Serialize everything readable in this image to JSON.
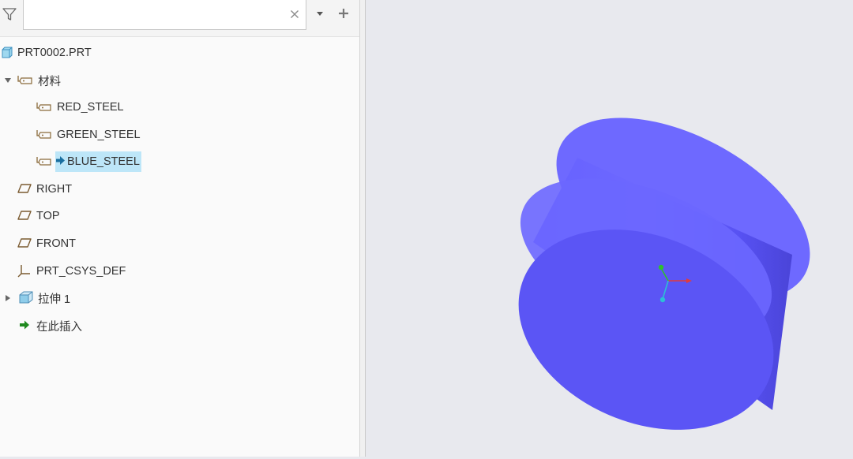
{
  "search": {
    "value": "",
    "placeholder": ""
  },
  "toolbar": {
    "filter_icon": "funnel-icon",
    "clear_icon": "close-icon",
    "dropdown_icon": "caret-down-icon",
    "add_icon": "plus-icon"
  },
  "tree": {
    "root": {
      "label": "PRT0002.PRT",
      "icon": "part-icon"
    },
    "materials": {
      "label": "材料",
      "icon": "material-tag-icon",
      "expanded": true,
      "items": [
        {
          "label": "RED_STEEL",
          "icon": "material-tag-icon"
        },
        {
          "label": "GREEN_STEEL",
          "icon": "material-tag-icon"
        },
        {
          "label": "BLUE_STEEL",
          "icon": "material-tag-icon",
          "active": true,
          "marker": "arrow-right-icon"
        }
      ]
    },
    "datums": [
      {
        "label": "RIGHT",
        "icon": "datum-plane-icon"
      },
      {
        "label": "TOP",
        "icon": "datum-plane-icon"
      },
      {
        "label": "FRONT",
        "icon": "datum-plane-icon"
      },
      {
        "label": "PRT_CSYS_DEF",
        "icon": "coordinate-system-icon"
      }
    ],
    "extrude": {
      "label": "拉伸 1",
      "icon": "extrude-feature-icon",
      "expanded": false
    },
    "insert_here": {
      "label": "在此插入",
      "icon": "insert-arrow-icon"
    }
  },
  "viewport": {
    "model": "cylinder",
    "model_color": "#5b55f5",
    "background": "#e8e9ee",
    "axis_colors": {
      "x": "#e23b3b",
      "y": "#2ec02e",
      "z": "#2cbfd6"
    }
  }
}
